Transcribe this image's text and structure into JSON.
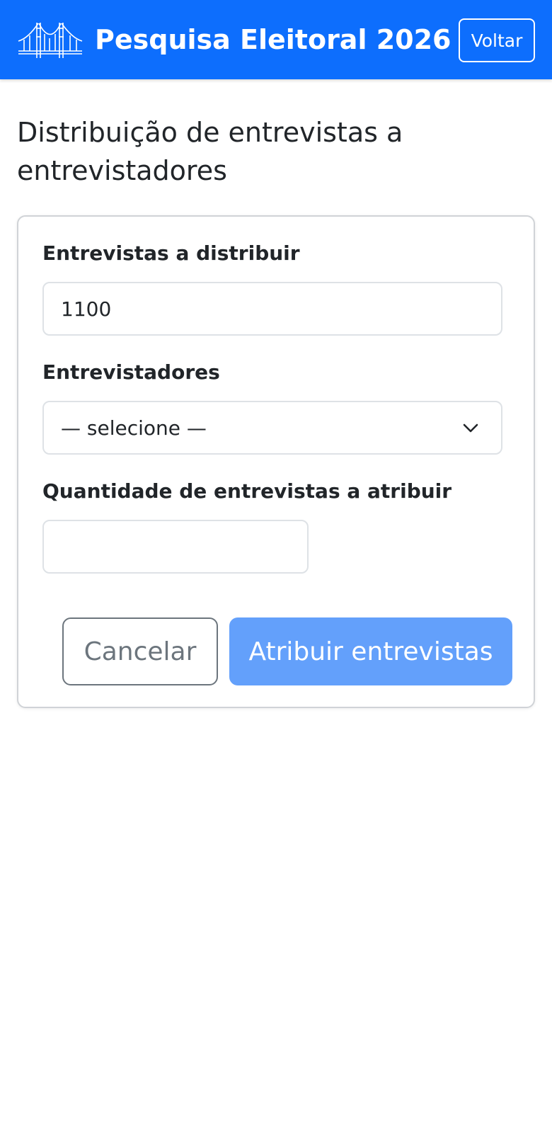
{
  "header": {
    "logo_icon": "bridge-logo-icon",
    "title": "Pesquisa Eleitoral 2026",
    "back_label": "Voltar",
    "background_color": "#0d6efd"
  },
  "page": {
    "title": "Distribuição de entrevistas a entrevistadores"
  },
  "form": {
    "interviews_label": "Entrevistas a distribuir",
    "interviews_value": "1100",
    "interviewers_label": "Entrevistadores",
    "interviewers_selected": "— selecione —",
    "quantity_label": "Quantidade de entrevistas a atribuir",
    "quantity_value": "",
    "cancel_label": "Cancelar",
    "submit_label": "Atribuir entrevistas",
    "submit_color": "#63a0fb"
  }
}
